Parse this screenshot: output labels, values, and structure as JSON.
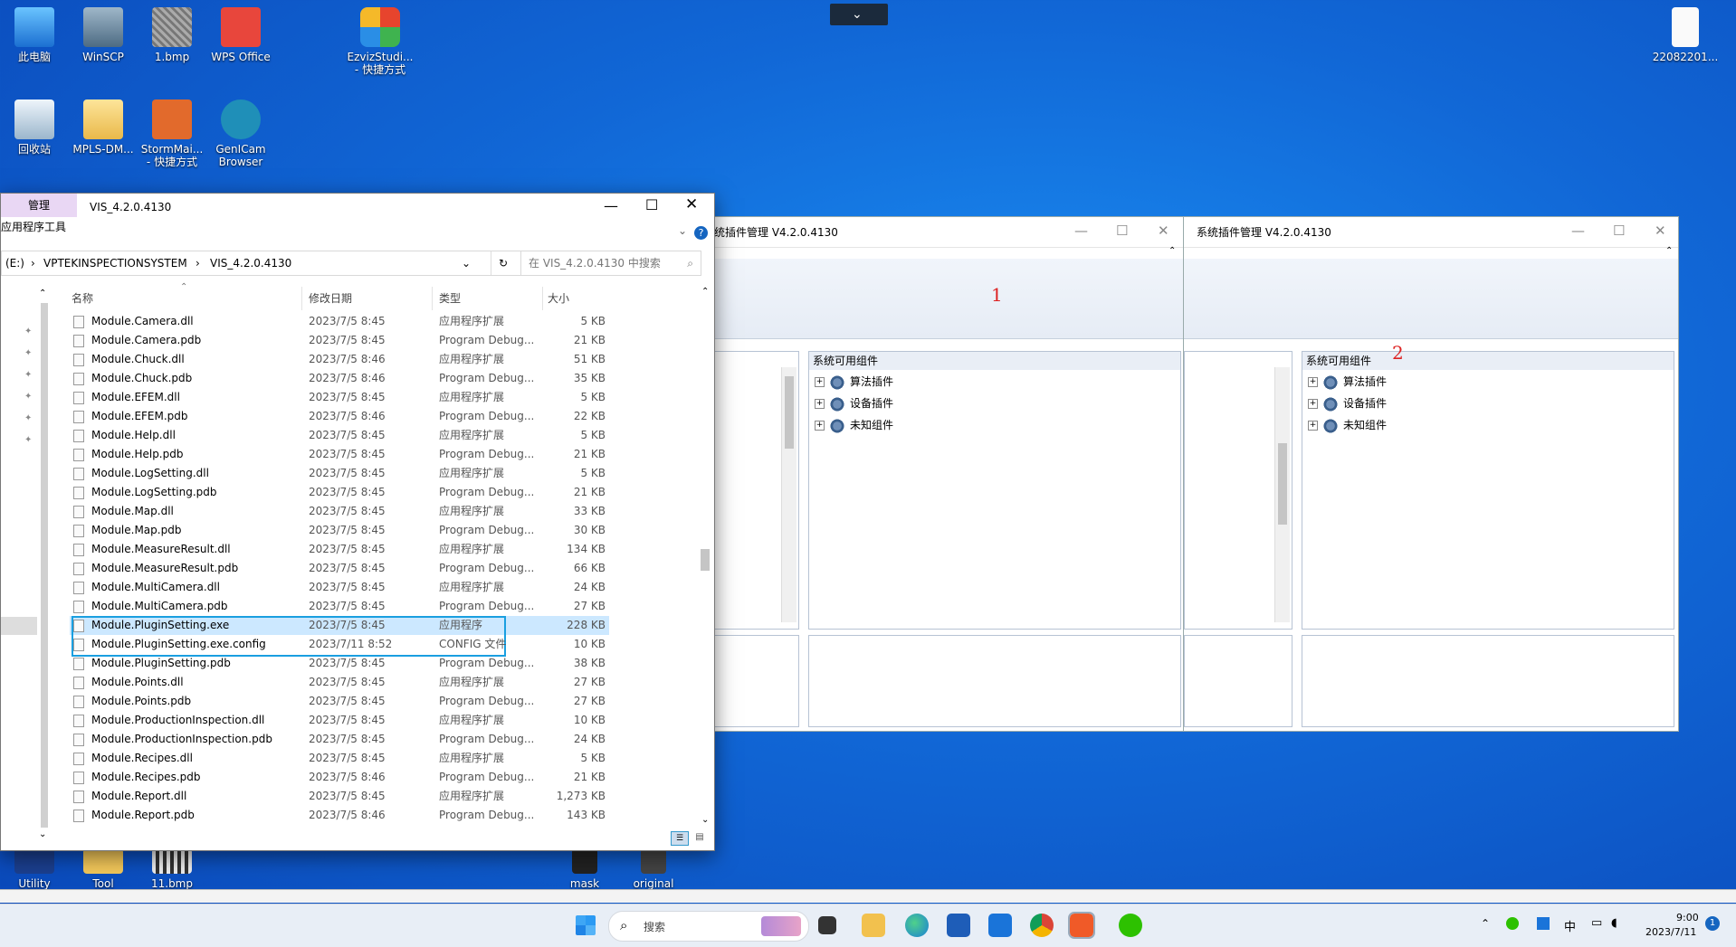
{
  "desktop": {
    "icons": [
      {
        "label": "此电脑"
      },
      {
        "label": "WinSCP"
      },
      {
        "label": "1.bmp"
      },
      {
        "label": "WPS Office"
      },
      {
        "label": "EzvizStudi... - 快捷方式"
      },
      {
        "label": "22082201..."
      },
      {
        "label": "回收站"
      },
      {
        "label": "MPLS-DM..."
      },
      {
        "label": "StormMai... - 快捷方式"
      },
      {
        "label": "GenICam Browser"
      },
      {
        "label": "Utility"
      },
      {
        "label": "Tool"
      },
      {
        "label": "11.bmp"
      },
      {
        "label": "mask"
      },
      {
        "label": "original"
      }
    ]
  },
  "explorer": {
    "title": "VIS_4.2.0.4130",
    "ribbon_tab": "管理",
    "ribbon_sub": "应用程序工具",
    "addr_drive": "(E:)",
    "addr_seg1": "VPTEKINSPECTIONSYSTEM",
    "addr_seg2": "VIS_4.2.0.4130",
    "search_placeholder": "在 VIS_4.2.0.4130 中搜索",
    "columns": {
      "name": "名称",
      "date": "修改日期",
      "type": "类型",
      "size": "大小"
    },
    "rows": [
      {
        "n": "Module.Camera.dll",
        "d": "2023/7/5 8:45",
        "t": "应用程序扩展",
        "s": "5 KB"
      },
      {
        "n": "Module.Camera.pdb",
        "d": "2023/7/5 8:45",
        "t": "Program Debug...",
        "s": "21 KB"
      },
      {
        "n": "Module.Chuck.dll",
        "d": "2023/7/5 8:46",
        "t": "应用程序扩展",
        "s": "51 KB"
      },
      {
        "n": "Module.Chuck.pdb",
        "d": "2023/7/5 8:46",
        "t": "Program Debug...",
        "s": "35 KB"
      },
      {
        "n": "Module.EFEM.dll",
        "d": "2023/7/5 8:45",
        "t": "应用程序扩展",
        "s": "5 KB"
      },
      {
        "n": "Module.EFEM.pdb",
        "d": "2023/7/5 8:46",
        "t": "Program Debug...",
        "s": "22 KB"
      },
      {
        "n": "Module.Help.dll",
        "d": "2023/7/5 8:45",
        "t": "应用程序扩展",
        "s": "5 KB"
      },
      {
        "n": "Module.Help.pdb",
        "d": "2023/7/5 8:45",
        "t": "Program Debug...",
        "s": "21 KB"
      },
      {
        "n": "Module.LogSetting.dll",
        "d": "2023/7/5 8:45",
        "t": "应用程序扩展",
        "s": "5 KB"
      },
      {
        "n": "Module.LogSetting.pdb",
        "d": "2023/7/5 8:45",
        "t": "Program Debug...",
        "s": "21 KB"
      },
      {
        "n": "Module.Map.dll",
        "d": "2023/7/5 8:45",
        "t": "应用程序扩展",
        "s": "33 KB"
      },
      {
        "n": "Module.Map.pdb",
        "d": "2023/7/5 8:45",
        "t": "Program Debug...",
        "s": "30 KB"
      },
      {
        "n": "Module.MeasureResult.dll",
        "d": "2023/7/5 8:45",
        "t": "应用程序扩展",
        "s": "134 KB"
      },
      {
        "n": "Module.MeasureResult.pdb",
        "d": "2023/7/5 8:45",
        "t": "Program Debug...",
        "s": "66 KB"
      },
      {
        "n": "Module.MultiCamera.dll",
        "d": "2023/7/5 8:45",
        "t": "应用程序扩展",
        "s": "24 KB"
      },
      {
        "n": "Module.MultiCamera.pdb",
        "d": "2023/7/5 8:45",
        "t": "Program Debug...",
        "s": "27 KB"
      },
      {
        "n": "Module.PluginSetting.exe",
        "d": "2023/7/5 8:45",
        "t": "应用程序",
        "s": "228 KB"
      },
      {
        "n": "Module.PluginSetting.exe.config",
        "d": "2023/7/11 8:52",
        "t": "CONFIG 文件",
        "s": "10 KB"
      },
      {
        "n": "Module.PluginSetting.pdb",
        "d": "2023/7/5 8:45",
        "t": "Program Debug...",
        "s": "38 KB"
      },
      {
        "n": "Module.Points.dll",
        "d": "2023/7/5 8:45",
        "t": "应用程序扩展",
        "s": "27 KB"
      },
      {
        "n": "Module.Points.pdb",
        "d": "2023/7/5 8:45",
        "t": "Program Debug...",
        "s": "27 KB"
      },
      {
        "n": "Module.ProductionInspection.dll",
        "d": "2023/7/5 8:45",
        "t": "应用程序扩展",
        "s": "10 KB"
      },
      {
        "n": "Module.ProductionInspection.pdb",
        "d": "2023/7/5 8:45",
        "t": "Program Debug...",
        "s": "24 KB"
      },
      {
        "n": "Module.Recipes.dll",
        "d": "2023/7/5 8:45",
        "t": "应用程序扩展",
        "s": "5 KB"
      },
      {
        "n": "Module.Recipes.pdb",
        "d": "2023/7/5 8:46",
        "t": "Program Debug...",
        "s": "21 KB"
      },
      {
        "n": "Module.Report.dll",
        "d": "2023/7/5 8:45",
        "t": "应用程序扩展",
        "s": "1,273 KB"
      },
      {
        "n": "Module.Report.pdb",
        "d": "2023/7/5 8:46",
        "t": "Program Debug...",
        "s": "143 KB"
      }
    ]
  },
  "plugin1": {
    "title": "统插件管理 V4.2.0.4130",
    "annotation": "1",
    "group_title": "系统可用组件",
    "tree": [
      "算法插件",
      "设备插件",
      "未知组件"
    ]
  },
  "plugin2": {
    "title": "系统插件管理 V4.2.0.4130",
    "annotation": "2",
    "group_title": "系统可用组件",
    "tree": [
      "算法插件",
      "设备插件",
      "未知组件"
    ]
  },
  "taskbar": {
    "search_label": "搜索",
    "ime": "中",
    "time": "9:00",
    "date": "2023/7/11",
    "notify_count": "1"
  },
  "colors": {
    "accent": "#1a9fe0",
    "selection": "#cce8ff",
    "ribbon": "#e9d7f4"
  }
}
